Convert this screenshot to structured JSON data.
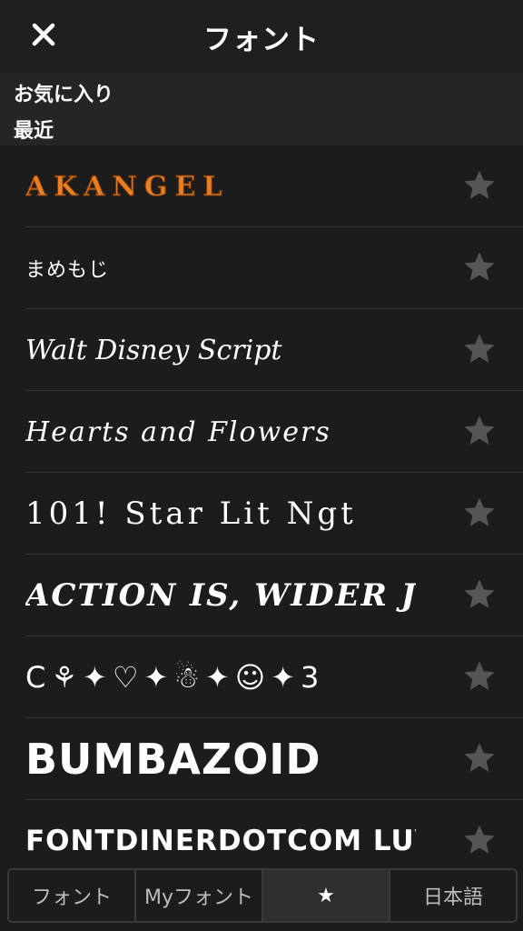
{
  "header": {
    "title": "フォント",
    "close_icon": "close-icon"
  },
  "sections": {
    "favorites": "お気に入り",
    "recent": "最近"
  },
  "fonts": [
    {
      "name": "AKANGEL",
      "starred": false
    },
    {
      "name": "まめもじ",
      "starred": false
    },
    {
      "name": "Walt Disney Script",
      "starred": false
    },
    {
      "name": "Hearts and Flowers",
      "starred": false
    },
    {
      "name": "101! Star Lit Ngt",
      "starred": false
    },
    {
      "name": "ACTION IS, WIDER J",
      "starred": false
    },
    {
      "name": "C⚘✦♡✦☃✦☺✦3",
      "starred": false
    },
    {
      "name": "BUMBAZOID",
      "starred": false
    },
    {
      "name": "FONTDINERDOTCOM LUVA",
      "starred": false
    }
  ],
  "tabs": [
    {
      "label": "フォント",
      "active": false
    },
    {
      "label": "Myフォント",
      "active": false
    },
    {
      "label": "★",
      "active": true
    },
    {
      "label": "日本語",
      "active": false
    }
  ],
  "colors": {
    "background": "#1c1c1c",
    "star": "#555555",
    "accent": "#e87f24"
  }
}
